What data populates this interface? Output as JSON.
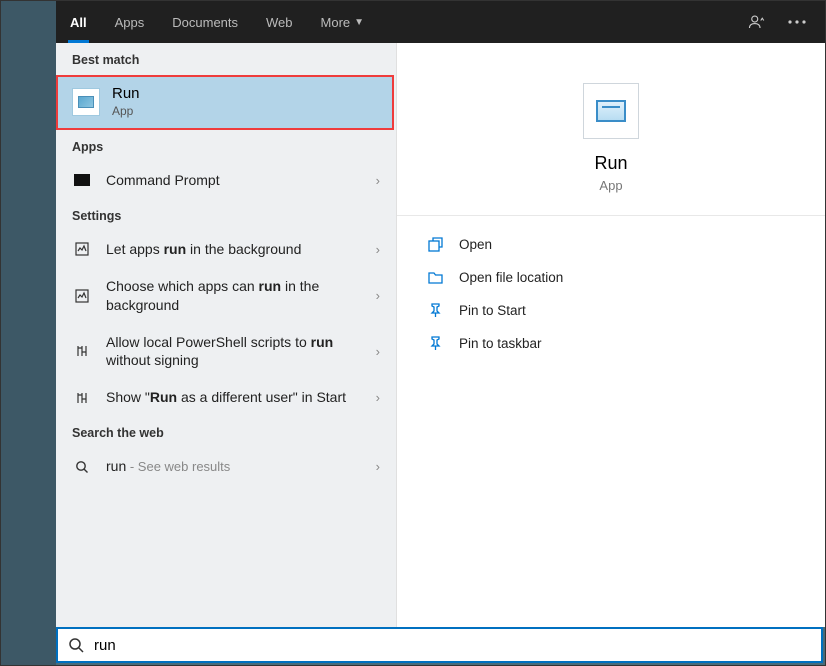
{
  "header": {
    "tabs": [
      "All",
      "Apps",
      "Documents",
      "Web",
      "More"
    ]
  },
  "sections": {
    "best_match": "Best match",
    "apps": "Apps",
    "settings": "Settings",
    "web": "Search the web"
  },
  "best_match": {
    "title": "Run",
    "subtitle": "App"
  },
  "apps_results": [
    {
      "label": "Command Prompt"
    }
  ],
  "settings_results": [
    {
      "pre": "Let apps ",
      "bold": "run",
      "post": " in the background"
    },
    {
      "pre": "Choose which apps can ",
      "bold": "run",
      "post": " in the background"
    },
    {
      "pre": "Allow local PowerShell scripts to ",
      "bold": "run",
      "post": " without signing"
    },
    {
      "pre": "Show \"",
      "bold": "Run",
      "post": " as a different user\" in Start"
    }
  ],
  "web_result": {
    "query": "run",
    "hint": " - See web results"
  },
  "preview": {
    "title": "Run",
    "subtitle": "App"
  },
  "actions": {
    "open": "Open",
    "location": "Open file location",
    "pin_start": "Pin to Start",
    "pin_taskbar": "Pin to taskbar"
  },
  "search": {
    "value": "run"
  }
}
